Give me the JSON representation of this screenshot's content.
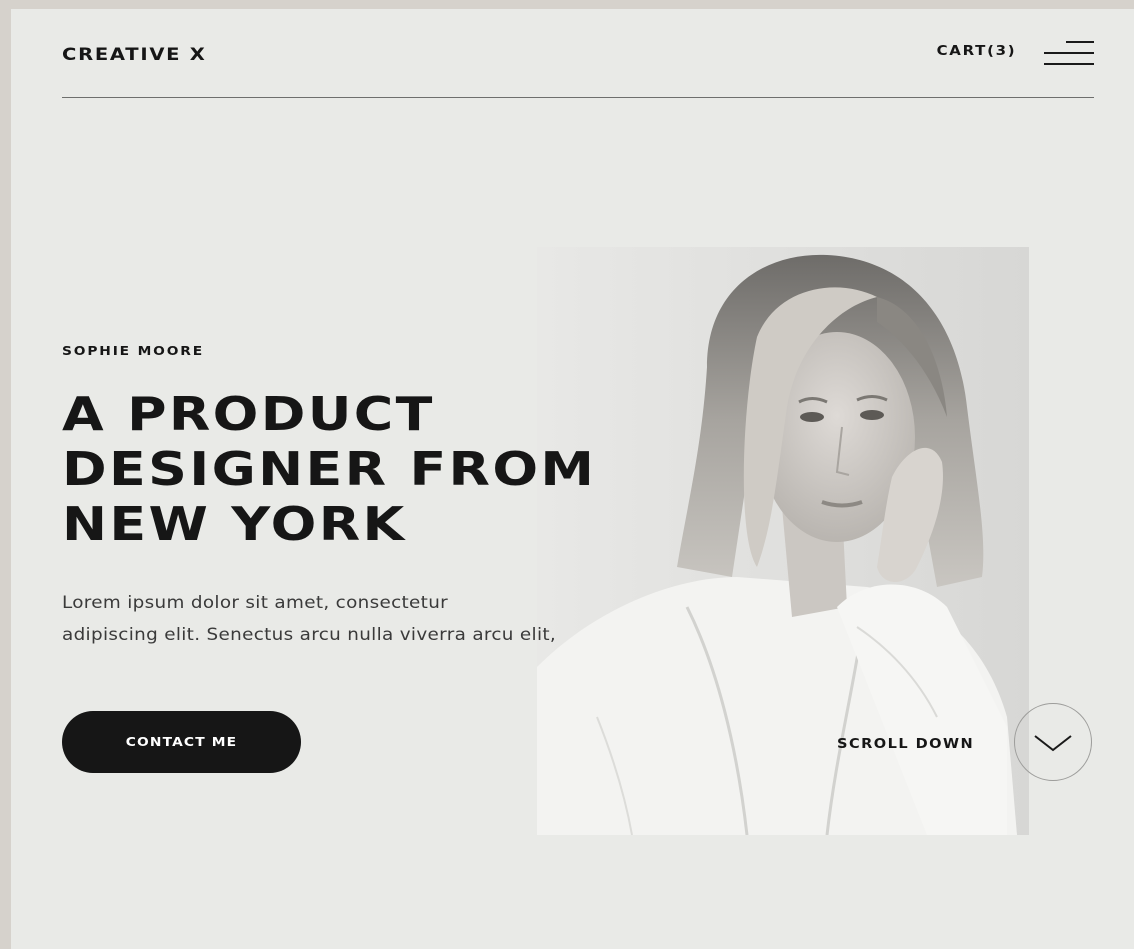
{
  "header": {
    "brand": "CREATIVE X",
    "cart_label": "CART(3)",
    "menu_icon": "hamburger-menu-icon"
  },
  "hero": {
    "name": "SOPHIE MOORE",
    "headline_lines": [
      "A PRODUCT",
      "DESIGNER FROM",
      "NEW YORK"
    ],
    "intro_lines": [
      "Lorem ipsum dolor sit amet, consectetur",
      "adipiscing elit. Senectus arcu nulla viverra arcu elit,"
    ],
    "cta_label": "CONTACT ME",
    "scroll_label": "SCROLL DOWN",
    "scroll_icon": "chevron-down-icon"
  },
  "colors": {
    "page_bg": "#e9eae7",
    "frame_bg": "#d6d2cc",
    "text": "#161616",
    "cta_bg": "#161616",
    "cta_text": "#ffffff"
  }
}
